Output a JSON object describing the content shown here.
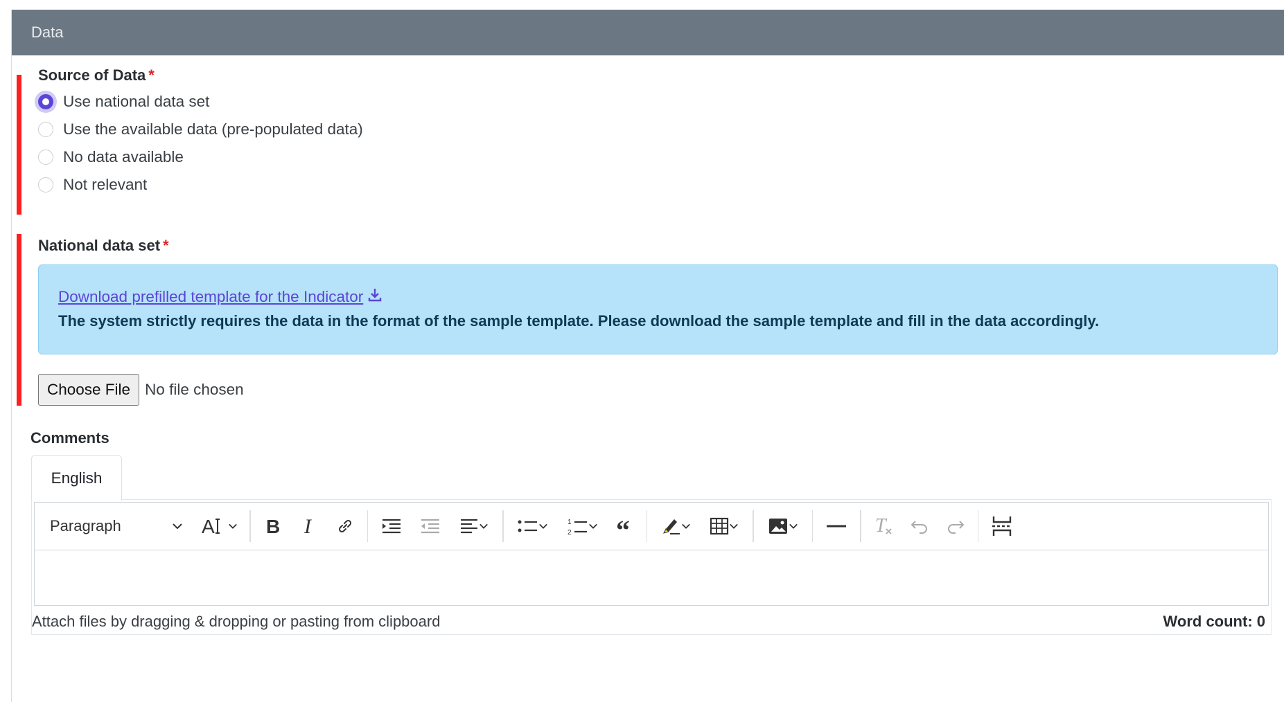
{
  "card": {
    "header_title": "Data"
  },
  "source_of_data": {
    "label": "Source of Data",
    "required_marker": "*",
    "options": [
      {
        "label": "Use national data set",
        "checked": true
      },
      {
        "label": "Use the available data (pre-populated data)",
        "checked": false
      },
      {
        "label": "No data available",
        "checked": false
      },
      {
        "label": "Not relevant",
        "checked": false
      }
    ]
  },
  "national_data_set": {
    "label": "National data set",
    "required_marker": "*",
    "download_link": "Download prefilled template for the Indicator",
    "note": "The system strictly requires the data in the format of the sample template. Please download the sample template and fill in the data accordingly.",
    "file_button": "Choose File",
    "file_status": "No file chosen"
  },
  "comments": {
    "label": "Comments",
    "tab": "English",
    "paragraph_select": "Paragraph",
    "attach_hint": "Attach files by dragging & dropping or pasting from clipboard",
    "word_count": "Word count: 0"
  },
  "toolbar_icons": [
    "font-size-icon",
    "bold-icon",
    "italic-icon",
    "link-icon",
    "indent-icon",
    "outdent-icon",
    "align-icon",
    "bulleted-list-icon",
    "numbered-list-icon",
    "quote-icon",
    "highlight-icon",
    "table-icon",
    "image-icon",
    "horizontal-line-icon",
    "remove-format-icon",
    "undo-icon",
    "redo-icon",
    "page-break-icon"
  ],
  "colors": {
    "header_bg": "#6c7784",
    "required_bar": "#ff1f1f",
    "accent": "#5b45d6",
    "alert_bg": "#b6e2fa"
  }
}
